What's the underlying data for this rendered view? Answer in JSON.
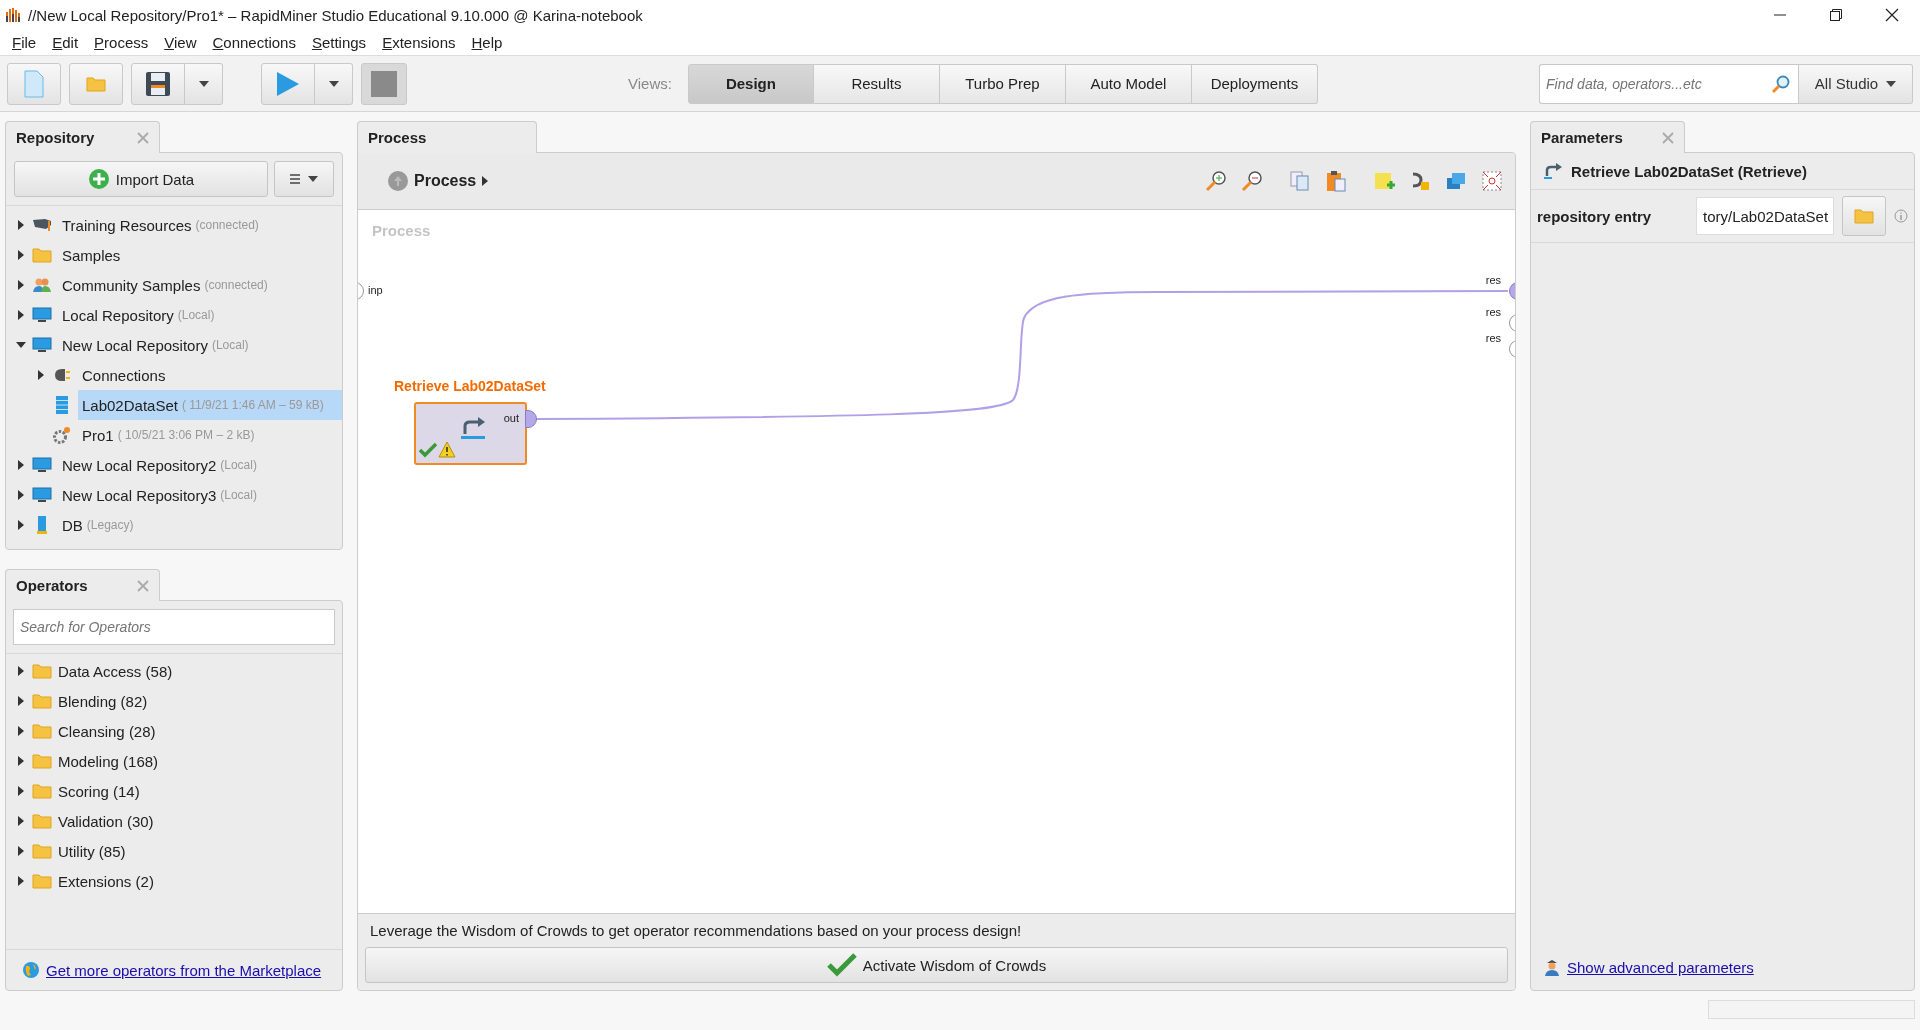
{
  "window": {
    "title": "//New Local Repository/Pro1* – RapidMiner Studio Educational 9.10.000 @ Karina-notebook"
  },
  "menu": [
    "File",
    "Edit",
    "Process",
    "View",
    "Connections",
    "Settings",
    "Extensions",
    "Help"
  ],
  "views": {
    "label": "Views:",
    "tabs": [
      {
        "label": "Design",
        "selected": true
      },
      {
        "label": "Results",
        "selected": false
      },
      {
        "label": "Turbo Prep",
        "selected": false
      },
      {
        "label": "Auto Model",
        "selected": false
      },
      {
        "label": "Deployments",
        "selected": false
      }
    ]
  },
  "search": {
    "placeholder": "Find data, operators...etc",
    "scope": "All Studio"
  },
  "repository": {
    "title": "Repository",
    "import_button": "Import Data",
    "items": [
      {
        "kind": "training",
        "name": "Training Resources",
        "note": "(connected)",
        "expanded": false,
        "selected": false
      },
      {
        "kind": "folder",
        "name": "Samples",
        "expanded": false,
        "selected": false
      },
      {
        "kind": "community",
        "name": "Community Samples",
        "note": "(connected)",
        "expanded": false,
        "selected": false
      },
      {
        "kind": "monitor",
        "name": "Local Repository",
        "note": "(Local)",
        "expanded": false,
        "selected": false
      },
      {
        "kind": "monitor",
        "name": "New Local Repository",
        "note": "(Local)",
        "expanded": true,
        "selected": false,
        "children": [
          {
            "kind": "connections",
            "name": "Connections",
            "expanded": false,
            "selected": false
          },
          {
            "kind": "dataset",
            "name": "Lab02DataSet",
            "note": "( 11/9/21 1:46 AM – 59 kB)",
            "selected": true
          },
          {
            "kind": "process",
            "name": "Pro1",
            "note": "( 10/5/21 3:06 PM – 2 kB)",
            "selected": false
          }
        ]
      },
      {
        "kind": "monitor",
        "name": "New Local Repository2",
        "note": "(Local)",
        "expanded": false,
        "selected": false
      },
      {
        "kind": "monitor",
        "name": "New Local Repository3",
        "note": "(Local)",
        "expanded": false,
        "selected": false
      },
      {
        "kind": "db",
        "name": "DB",
        "note": "(Legacy)",
        "expanded": false,
        "selected": false
      }
    ]
  },
  "operators": {
    "title": "Operators",
    "search_placeholder": "Search for Operators",
    "items": [
      {
        "name": "Data Access (58)",
        "expanded": false
      },
      {
        "name": "Blending (82)",
        "expanded": false
      },
      {
        "name": "Cleansing (28)",
        "expanded": false
      },
      {
        "name": "Modeling (168)",
        "expanded": false
      },
      {
        "name": "Scoring (14)",
        "expanded": false
      },
      {
        "name": "Validation (30)",
        "expanded": false
      },
      {
        "name": "Utility (85)",
        "expanded": false
      },
      {
        "name": "Extensions (2)",
        "expanded": false
      }
    ],
    "marketplace_link": "Get more operators from the Marketplace"
  },
  "process": {
    "tab": "Process",
    "breadcrumb": "Process",
    "canvas_label": "Process",
    "input_ports": [
      {
        "label": "inp",
        "connected": false
      }
    ],
    "output_ports": [
      {
        "label": "res",
        "connected": true
      },
      {
        "label": "res",
        "connected": false
      },
      {
        "label": "res",
        "connected": false
      }
    ],
    "operator": {
      "name": "Retrieve Lab02DataSet",
      "port": "out",
      "connected": true
    },
    "recommendation": "Leverage the Wisdom of Crowds to get operator recommendations based on your process design!",
    "activate_button": "Activate Wisdom of Crowds"
  },
  "parameters": {
    "title": "Parameters",
    "operator": "Retrieve Lab02DataSet (Retrieve)",
    "rows": [
      {
        "label": "repository entry",
        "value": "tory/Lab02DataSet"
      }
    ],
    "advanced_link": "Show advanced parameters"
  }
}
